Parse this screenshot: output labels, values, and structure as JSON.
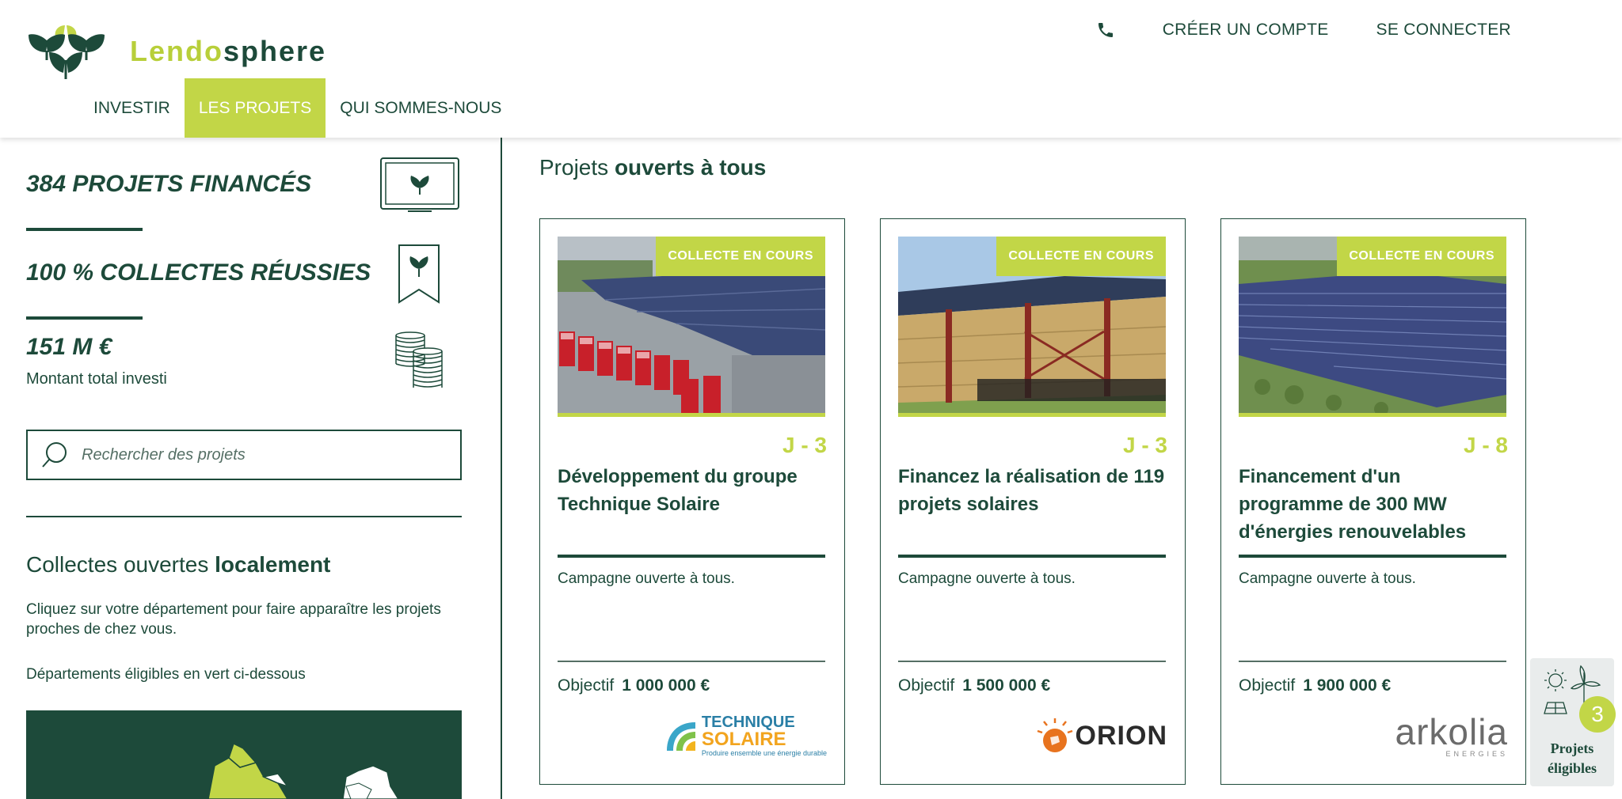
{
  "header": {
    "logo": {
      "part1": "Lendo",
      "part2": "sphere"
    },
    "top_links": {
      "create_account": "CRÉER UN COMPTE",
      "login": "SE CONNECTER"
    },
    "nav": [
      {
        "label": "INVESTIR",
        "active": false
      },
      {
        "label": "LES PROJETS",
        "active": true
      },
      {
        "label": "QUI SOMMES-NOUS",
        "active": false
      }
    ]
  },
  "sidebar": {
    "stats": [
      {
        "value": "384 PROJETS FINANCÉS",
        "icon": "screen-icon"
      },
      {
        "value": "100 % COLLECTES RÉUSSIES",
        "icon": "bookmark-icon"
      },
      {
        "value": "151 M €",
        "label": "Montant total investi",
        "icon": "coins-icon"
      }
    ],
    "search": {
      "placeholder": "Rechercher des projets"
    },
    "local": {
      "title_normal": "Collectes ouvertes ",
      "title_bold": "localement",
      "description": "Cliquez sur votre département pour faire apparaître les projets proches de chez vous.",
      "note": "Départements éligibles en vert ci-dessous"
    }
  },
  "main": {
    "title_normal": "Projets ",
    "title_bold": "ouverts à tous",
    "cards": [
      {
        "badge": "COLLECTE EN COURS",
        "days": "J - 3",
        "title": "Développement du groupe Technique Solaire",
        "description": "Campagne ouverte à tous.",
        "objective_label": "Objectif",
        "objective_value": "1 000 000 €",
        "partner": {
          "line1": "TECHNIQUE",
          "line2": "SOLAIRE",
          "tagline": "Produire ensemble une énergie durable"
        }
      },
      {
        "badge": "COLLECTE EN COURS",
        "days": "J - 3",
        "title": "Financez la réalisation de 119 projets solaires",
        "description": "Campagne ouverte à tous.",
        "objective_label": "Objectif",
        "objective_value": "1 500 000 €",
        "partner": {
          "name": "ORION"
        }
      },
      {
        "badge": "COLLECTE EN COURS",
        "days": "J - 8",
        "title": "Financement d'un programme de 300 MW d'énergies renouvelables",
        "description": "Campagne ouverte à tous.",
        "objective_label": "Objectif",
        "objective_value": "1 900 000 €",
        "partner": {
          "name": "arkolia",
          "sub": "ENERGIES"
        }
      }
    ]
  },
  "widget": {
    "count": "3",
    "label_line1": "Projets",
    "label_line2": "éligibles"
  },
  "colors": {
    "primary": "#1d4a3a",
    "accent": "#c2d647"
  }
}
